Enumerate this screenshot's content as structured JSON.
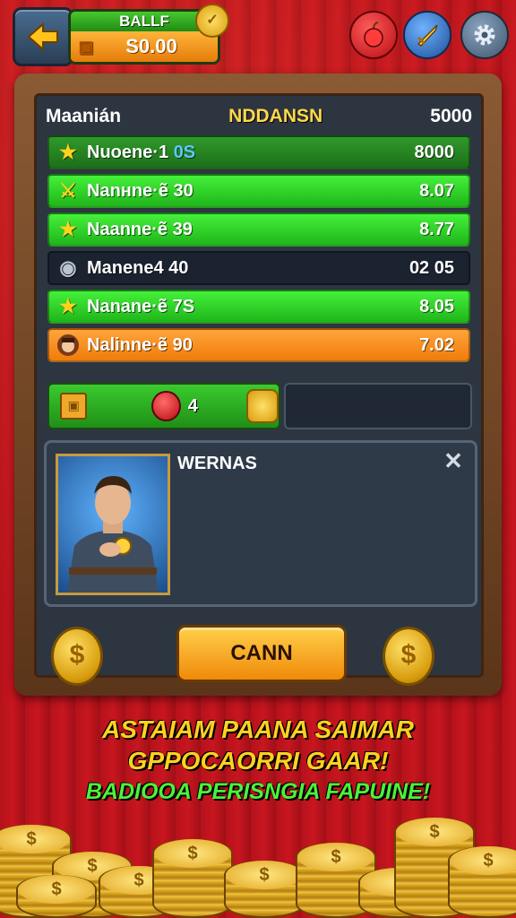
{
  "hud": {
    "balance_label": "BALLF",
    "balance_value": "S0.00",
    "balance_icon": "chest-icon",
    "buttons": [
      "back-arrow-icon",
      "apple-icon",
      "sword-icon",
      "gear-icon"
    ]
  },
  "leaderboard": {
    "header_left": "Maanián",
    "header_center": "NDDANSN",
    "header_right": "5000",
    "rows": [
      {
        "icon": "star-icon",
        "name": "Nuoene·1 ",
        "name_suffix": "0S",
        "score": "8000"
      },
      {
        "icon": "sword-icon",
        "name": "Nanнne·ẽ 30",
        "name_suffix": "",
        "score": "8.07"
      },
      {
        "icon": "star-icon",
        "name": "Naanne·ẽ 39",
        "name_suffix": "",
        "score": "8.77"
      },
      {
        "icon": "shield-icon",
        "name": "Manene4 40",
        "name_suffix": "",
        "score": "02 05"
      },
      {
        "icon": "star-icon",
        "name": "Nanane·ẽ 7S",
        "name_suffix": "",
        "score": "8.05"
      },
      {
        "icon": "avatar-icon",
        "name": "Nalinne·ẽ 90",
        "name_suffix": "",
        "score": "7.02"
      }
    ]
  },
  "resources": {
    "apple_count": "4"
  },
  "info": {
    "title": "WERNAS",
    "close": "✕"
  },
  "actions": {
    "cann_label": "CANN",
    "coin_symbol": "$"
  },
  "banner": {
    "line1": "ASTAIAM PAANA SAIMAR",
    "line2": "GPPOCAORRI GAAR!",
    "line3": "BADIOOA PERISNGIA FAPUINE!"
  },
  "colors": {
    "background_red": "#c8161f",
    "row_green": "#2fd82a",
    "row_orange": "#f59020",
    "banner_yellow": "#ffd21f",
    "banner_green": "#4cf23a"
  }
}
